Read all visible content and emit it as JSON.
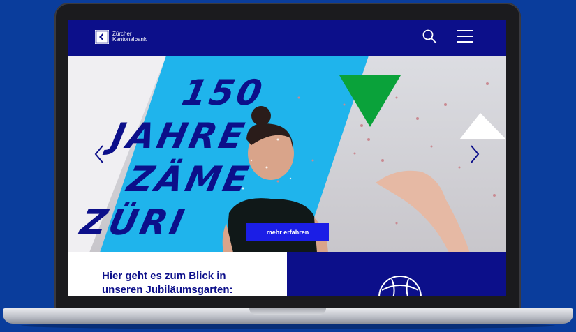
{
  "brand": {
    "name_line1": "Zürcher",
    "name_line2": "Kantonalbank"
  },
  "header": {
    "search_icon": "search-icon",
    "menu_icon": "hamburger-menu-icon"
  },
  "hero": {
    "title_lines": [
      "150",
      "JAHRE",
      "ZÄME",
      "ZÜRI"
    ],
    "cta_label": "mehr erfahren",
    "prev_icon": "chevron-left-icon",
    "next_icon": "chevron-right-icon"
  },
  "teaser": {
    "text": "Hier geht es zum Blick in unseren Jubiläumsgarten:"
  },
  "colors": {
    "page_background": "#0a3d9c",
    "brand_navy": "#0c0f8a",
    "accent_cyan": "#1fb4ec",
    "accent_green": "#0aa23a",
    "cta_blue": "#1b1ee6"
  }
}
